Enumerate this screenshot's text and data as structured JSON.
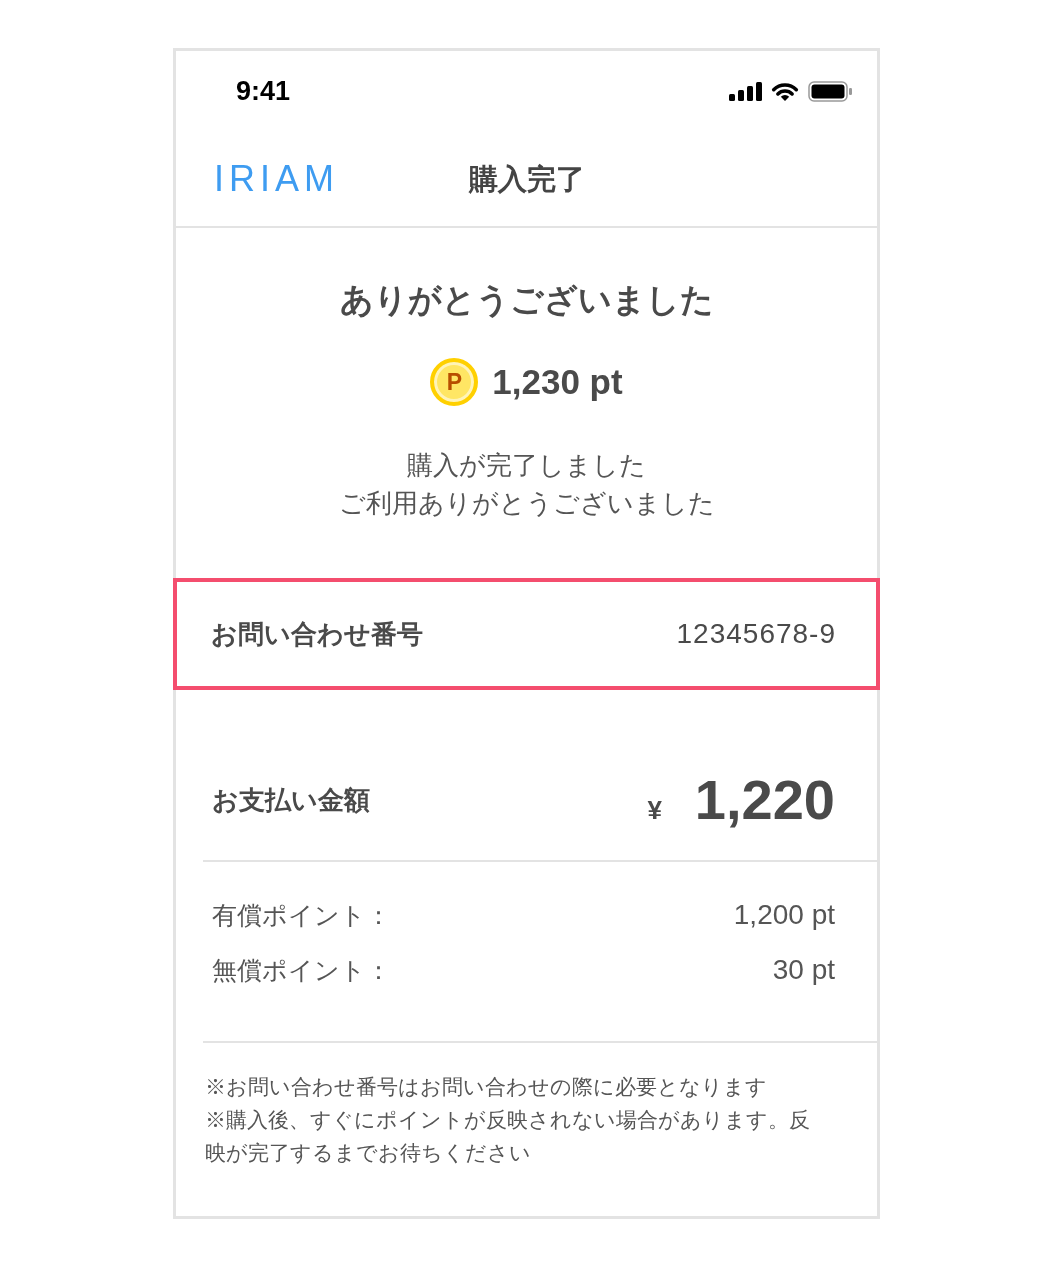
{
  "status_bar": {
    "time": "9:41"
  },
  "header": {
    "logo": "IRIAM",
    "title": "購入完了"
  },
  "thanks": {
    "heading": "ありがとうございました",
    "coin_mark": "P",
    "points": "1,230 pt",
    "message_lines": [
      "購入が完了しました",
      "ご利用ありがとうございました"
    ]
  },
  "inquiry": {
    "label": "お問い合わせ番号",
    "value": "12345678-9",
    "highlighted": true
  },
  "payment": {
    "label": "お支払い金額",
    "currency": "¥",
    "amount": "1,220"
  },
  "breakdown": [
    {
      "label": "有償ポイント：",
      "value": "1,200 pt"
    },
    {
      "label": "無償ポイント：",
      "value": "30 pt"
    }
  ],
  "notes": [
    "※お問い合わせ番号はお問い合わせの際に必要となります",
    "※購入後、すぐにポイントが反映されない場合があります。反映が完了するまでお待ちください"
  ]
}
